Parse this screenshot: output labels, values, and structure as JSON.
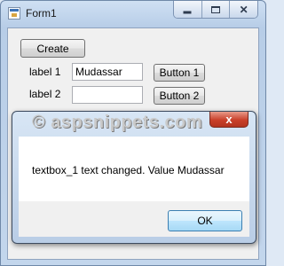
{
  "window": {
    "title": "Form1"
  },
  "form": {
    "create_label": "Create",
    "label1": "label 1",
    "label2": "label 2",
    "textbox1_value": "Mudassar",
    "textbox2_value": "",
    "button1_label": "Button 1",
    "button2_label": "Button 2"
  },
  "messagebox": {
    "watermark": "© aspsnippets.com",
    "close_glyph": "x",
    "message": "textbox_1 text changed. Value Mudassar",
    "ok_label": "OK"
  },
  "icons": {
    "app": "form-app-icon",
    "minimize": "minimize-icon",
    "maximize": "maximize-icon",
    "close": "close-icon"
  },
  "colors": {
    "close_button": "#c9402a",
    "ok_button_border": "#3c7fb1",
    "window_frame": "#b7cde7"
  }
}
